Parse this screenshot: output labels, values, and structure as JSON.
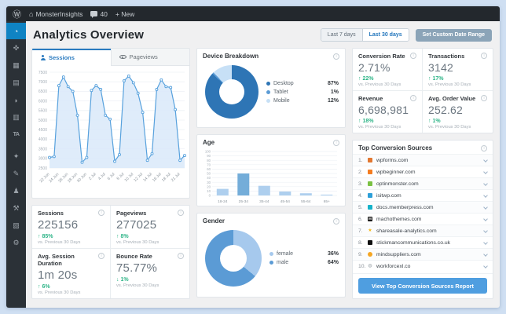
{
  "admin_bar": {
    "logo_glyph": "Ⓦ",
    "home_glyph": "⌂",
    "site_name": "MonsterInsights",
    "comments_count": "40",
    "new_label": "+ New"
  },
  "sidebar": {
    "items": [
      {
        "name": "dashboard",
        "glyph": "◔",
        "active": true
      },
      {
        "name": "posts",
        "glyph": "✜"
      },
      {
        "name": "media",
        "glyph": "▦"
      },
      {
        "name": "pages",
        "glyph": "▤"
      },
      {
        "name": "comments",
        "glyph": "◗"
      },
      {
        "name": "feedback",
        "glyph": "▥"
      },
      {
        "name": "analytics",
        "glyph": "TA"
      },
      {
        "name": "plugins",
        "glyph": "✦"
      },
      {
        "name": "appearance",
        "glyph": "✎"
      },
      {
        "name": "users",
        "glyph": "♟"
      },
      {
        "name": "tools",
        "glyph": "⚒"
      },
      {
        "name": "insights",
        "glyph": "▧"
      },
      {
        "name": "settings",
        "glyph": "⚙"
      }
    ]
  },
  "page": {
    "title": "Analytics Overview"
  },
  "date_range": {
    "last7": "Last 7 days",
    "last30": "Last 30 days",
    "custom": "Set Custom Date Range"
  },
  "tabs": {
    "sessions": "Sessions",
    "pageviews": "Pageviews"
  },
  "stats_left": [
    {
      "label": "Sessions",
      "value": "225156",
      "delta": "↑ 85%",
      "note": "vs. Previous 30 Days"
    },
    {
      "label": "Pageviews",
      "value": "277025",
      "delta": "↑ 8%",
      "note": "vs. Previous 30 Days"
    },
    {
      "label": "Avg. Session Duration",
      "value": "1m 20s",
      "delta": "↑ 6%",
      "note": "vs. Previous 30 Days"
    },
    {
      "label": "Bounce Rate",
      "value": "75.77%",
      "delta": "↓ 1%",
      "note": "vs. Previous 30 Days"
    }
  ],
  "stats_right": [
    {
      "label": "Conversion Rate",
      "value": "2.71%",
      "delta": "↑ 22%",
      "note": "vs. Previous 30 Days"
    },
    {
      "label": "Transactions",
      "value": "3142",
      "delta": "↑ 17%",
      "note": "vs. Previous 30 Days"
    },
    {
      "label": "Revenue",
      "value": "6,698,981",
      "delta": "↑ 18%",
      "note": "vs. Previous 30 Days"
    },
    {
      "label": "Avg. Order Value",
      "value": "252.62",
      "delta": "↑ 1%",
      "note": "vs. Previous 30 Days"
    }
  ],
  "device_breakdown": {
    "title": "Device Breakdown",
    "legend": [
      {
        "label": "Desktop",
        "value": "87%"
      },
      {
        "label": "Tablet",
        "value": "1%"
      },
      {
        "label": "Mobile",
        "value": "12%"
      }
    ]
  },
  "age": {
    "title": "Age"
  },
  "gender": {
    "title": "Gender",
    "legend": [
      {
        "label": "female",
        "value": "36%"
      },
      {
        "label": "male",
        "value": "64%"
      }
    ]
  },
  "sources": {
    "title": "Top Conversion Sources",
    "button": "View Top Conversion Sources Report",
    "items": [
      {
        "rank": "1.",
        "domain": "wpforms.com",
        "icon": "wpforms-favicon",
        "color": "#e27730",
        "style": "square"
      },
      {
        "rank": "2.",
        "domain": "wpbeginner.com",
        "icon": "wpbeginner-favicon",
        "color": "#f47c20",
        "style": "square"
      },
      {
        "rank": "3.",
        "domain": "optinmonster.com",
        "icon": "optinmonster-favicon",
        "color": "#7ac143",
        "style": "square"
      },
      {
        "rank": "4.",
        "domain": "isitwp.com",
        "icon": "isitwp-favicon",
        "color": "#2d9fd8",
        "style": "square"
      },
      {
        "rank": "5.",
        "domain": "docs.memberpress.com",
        "icon": "memberpress-favicon",
        "color": "#14b2c9",
        "style": "square"
      },
      {
        "rank": "6.",
        "domain": "machothemes.com",
        "icon": "machothemes-favicon",
        "color": "#1a1a1a",
        "style": "letter",
        "glyph": "M"
      },
      {
        "rank": "7.",
        "domain": "shareasale-analytics.com",
        "icon": "shareasale-favicon",
        "color": "#f4b81a",
        "style": "glyph",
        "glyph": "★"
      },
      {
        "rank": "8.",
        "domain": "stickmancommunications.co.uk",
        "icon": "stickman-favicon",
        "color": "#101010",
        "style": "square"
      },
      {
        "rank": "9.",
        "domain": "mindsuppliers.com",
        "icon": "mindsuppliers-favicon",
        "color": "#f5a623",
        "style": "circle"
      },
      {
        "rank": "10.",
        "domain": "workforcexl.co",
        "icon": "workforcexl-favicon",
        "color": "#98a1a8",
        "style": "glyph",
        "glyph": "◍"
      }
    ]
  },
  "chart_data": [
    {
      "id": "sessions_over_time",
      "type": "line",
      "series_name": "Sessions",
      "values": [
        3050,
        3100,
        6800,
        7250,
        6750,
        6500,
        5250,
        2800,
        3050,
        6550,
        6800,
        6600,
        5250,
        5050,
        2850,
        3200,
        7050,
        7300,
        6950,
        6400,
        5400,
        2900,
        3250,
        6600,
        7100,
        6750,
        6700,
        5550,
        2900,
        3150
      ],
      "x_labels": [
        "22 Jun",
        "24 Jun",
        "26 Jun",
        "28 Jun",
        "30 Jun",
        "2 Jul",
        "4 Jul",
        "6 Jul",
        "8 Jul",
        "10 Jul",
        "12 Jul",
        "14 Jul",
        "16 Jul",
        "18 Jul",
        "21 Jul"
      ],
      "ylim": [
        2500,
        7500
      ],
      "ytick_step": 500,
      "grid": true,
      "line_color": "#57a1dd",
      "fill_color": "#d9e9f9"
    },
    {
      "id": "device_breakdown",
      "type": "pie",
      "labels": [
        "Desktop",
        "Tablet",
        "Mobile"
      ],
      "values": [
        87,
        1,
        12
      ],
      "colors": [
        "#2e75b5",
        "#5b9bd5",
        "#c7e0f6"
      ]
    },
    {
      "id": "age",
      "type": "bar",
      "title": "Age",
      "categories": [
        "18-24",
        "25-34",
        "35-44",
        "45-54",
        "55-64",
        "65+"
      ],
      "values": [
        15,
        50,
        22,
        9,
        5,
        2
      ],
      "ylim": [
        0,
        100
      ],
      "ytick_step": 10,
      "bar_color": "#aecfee",
      "highlight_index": 1,
      "highlight_color": "#74add9"
    },
    {
      "id": "gender",
      "type": "pie",
      "labels": [
        "female",
        "male"
      ],
      "values": [
        36,
        64
      ],
      "colors": [
        "#a6c9ed",
        "#5b9bd5"
      ]
    }
  ]
}
